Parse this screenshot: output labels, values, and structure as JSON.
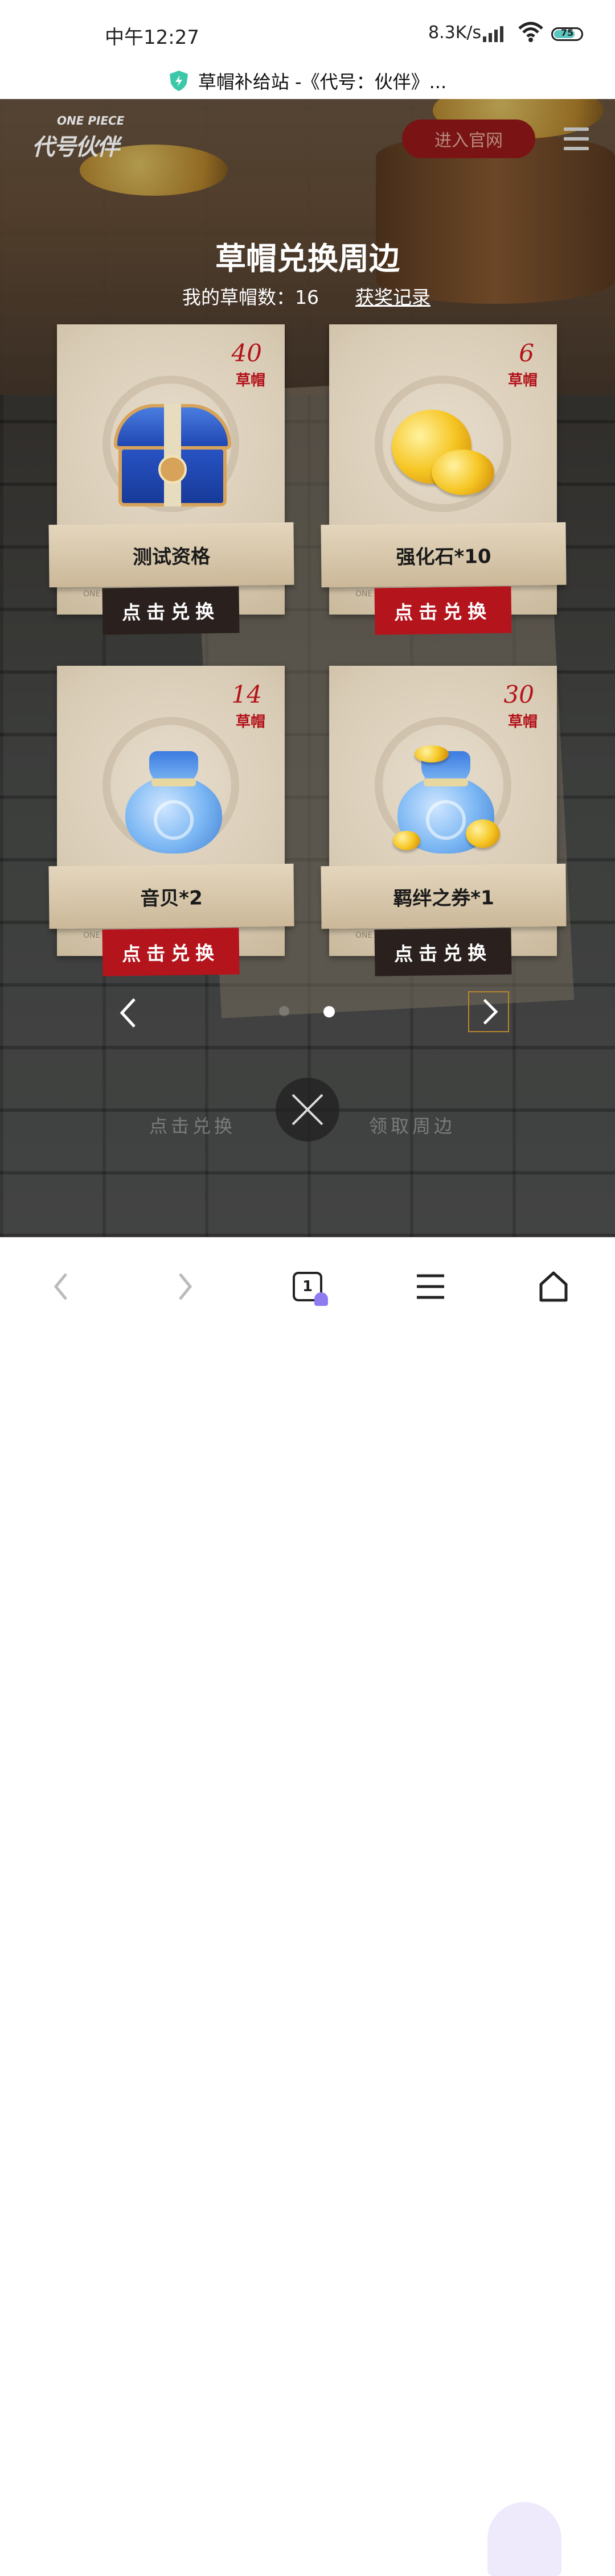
{
  "status_bar": {
    "time": "中午12:27",
    "net_speed": "8.3K/s",
    "battery": "75"
  },
  "browser": {
    "page_title": "草帽补给站 -《代号：伙伴》...",
    "tab_count": "1"
  },
  "header": {
    "logo_top": "ONE PIECE",
    "logo_main": "代号伙伴",
    "enter_site": "进入官网"
  },
  "hero": {
    "title": "草帽兑换周边",
    "hat_count_label": "我的草帽数：16",
    "record_link": "获奖记录"
  },
  "cards": [
    {
      "cost": "40",
      "unit": "草帽",
      "name": "测试资格",
      "button": "点击兑换",
      "style": "dark",
      "art": "treasure-chest"
    },
    {
      "cost": "6",
      "unit": "草帽",
      "name": "强化石*10",
      "button": "点击兑换",
      "style": "red",
      "art": "gold-coins"
    },
    {
      "cost": "14",
      "unit": "草帽",
      "name": "音贝*2",
      "button": "点击兑换",
      "style": "red",
      "art": "blue-bag"
    },
    {
      "cost": "30",
      "unit": "草帽",
      "name": "羁绊之券*1",
      "button": "点击兑换",
      "style": "dark",
      "art": "blue-bag-with-coins"
    }
  ],
  "card_footer_text": "ONE PIECE",
  "pager": {
    "pages": 2,
    "active": 2
  },
  "bottom_hints": {
    "left": "点击兑换",
    "right": "领取周边"
  },
  "colors": {
    "accent_red": "#b4141c",
    "dark_button": "#2a211f",
    "cost_red": "#b3141b"
  },
  "icons": [
    "shield-check-icon",
    "menu-icon",
    "chevron-left-icon",
    "chevron-right-icon",
    "close-icon",
    "back-icon",
    "forward-icon",
    "tabs-icon",
    "browser-menu-icon",
    "home-icon"
  ]
}
